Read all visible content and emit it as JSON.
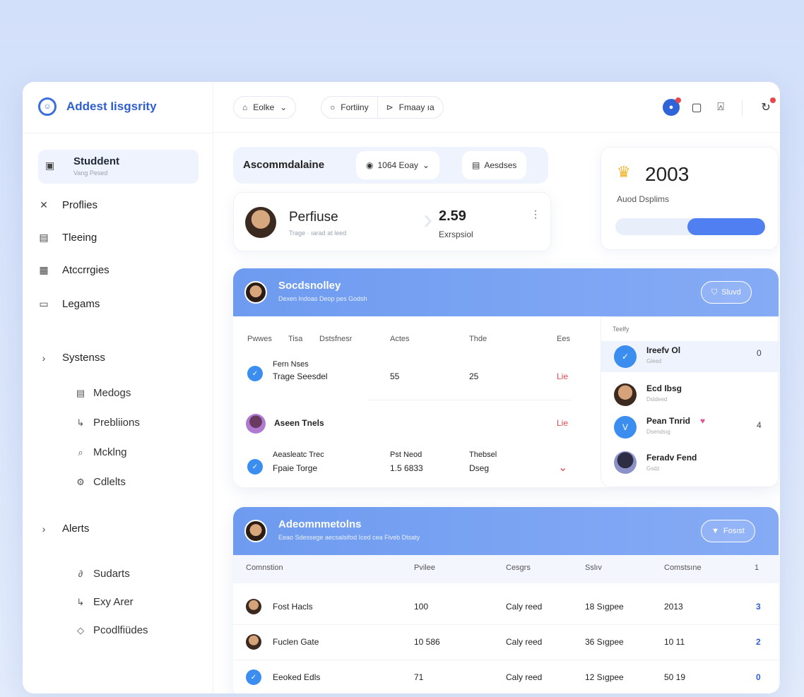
{
  "app": {
    "title": "Addest Iisgsrity",
    "logo_glyph": "☺",
    "accent": "#3b6fe0"
  },
  "sidebar": {
    "active": {
      "label": "Studdent",
      "sublabel": "Vang Pesed"
    },
    "items": [
      {
        "label": "Proflies",
        "icon": "close-icon"
      },
      {
        "label": "Tleeing",
        "icon": "calendar-icon"
      },
      {
        "label": "Atccrrgies",
        "icon": "document-icon"
      },
      {
        "label": "Legams",
        "icon": "chat-icon"
      }
    ],
    "group1": {
      "label": "Systenss"
    },
    "group1_items": [
      {
        "label": "Medogs"
      },
      {
        "label": "Prebliions"
      },
      {
        "label": "Mcklng"
      },
      {
        "label": "Cdlelts"
      }
    ],
    "group2": {
      "label": "Alerts"
    },
    "group2_items": [
      {
        "label": "Sudarts"
      },
      {
        "label": "Exy Arer"
      },
      {
        "label": "Pcodlfiüdes"
      }
    ]
  },
  "topbar": {
    "select_label": "Eolke",
    "segment_a": "Fortiiny",
    "segment_b": "Fmaay ıa"
  },
  "filterbar": {
    "title": "Ascommdalaine",
    "chip_a": "1064 Eoay",
    "chip_b": "Aesdses"
  },
  "profile": {
    "name": "Perfiuse",
    "sub": "Trage · ıarad at leed",
    "value": "2.59",
    "value_label": "Exrspsiol"
  },
  "stat": {
    "value": "2003",
    "label": "Auod Dsplims",
    "progress": 0.52
  },
  "panel1": {
    "title": "Socdsnolley",
    "subtitle": "Dexen Indoas Deop pes Godsh",
    "button": "Sluvd",
    "columns": [
      "Pwwes",
      "Tisa",
      "Dstsfnesr",
      "Actes",
      "Thde",
      "Ees"
    ],
    "rows": [
      {
        "name1": "Fern Nses",
        "name2": "Trage Seesdel",
        "c1": "55",
        "c2": "25",
        "c3": "Lie"
      },
      {
        "name1": "Aseen Tnels",
        "name2": "",
        "c1": "",
        "c2": "",
        "c3": "Lie"
      },
      {
        "name1": "Aeasleatc Trec",
        "name2": "Fpaie Torge",
        "c1": "Pst Neod",
        "c1b": "1.5 6833",
        "c2": "Thebsel",
        "c2b": "Dseg",
        "c3": "⌄"
      }
    ],
    "side_header": "Teelfy",
    "side_items": [
      {
        "name": "Ireefv Ol",
        "sub": "Gieed",
        "value": "0"
      },
      {
        "name": "Ecd Ibsg",
        "sub": "Dsldeed",
        "value": ""
      },
      {
        "name": "Pean Tnrid",
        "sub": "Dsendsıg",
        "value": "4",
        "heart": "♥"
      },
      {
        "name": "Feradv Fend",
        "sub": "Gsdz",
        "value": ""
      }
    ]
  },
  "panel2": {
    "title": "Adeomnmetolns",
    "subtitle": "Eeao Sdessege aecsalsifod Iced cea Fiveb Dtsaty",
    "button": "Fosıst",
    "columns": [
      "Comnstion",
      "Pvilee",
      "Cesgrs",
      "Sslıv",
      "Comstsıne",
      "1"
    ],
    "rows": [
      {
        "name": "Fost Hacls",
        "price": "100",
        "cat": "Caly reed",
        "slv": "18 Sıgpee",
        "cmp": "2013",
        "n": "3"
      },
      {
        "name": "Fuclen Gate",
        "price": "10 586",
        "cat": "Caly reed",
        "slv": "36 Sıgpee",
        "cmp": "10 11",
        "n": "2"
      },
      {
        "name": "Eeoked Edls",
        "price": "71",
        "cat": "Caly reed",
        "slv": "12 Sıgpee",
        "cmp": "50 19",
        "n": "0"
      }
    ]
  }
}
